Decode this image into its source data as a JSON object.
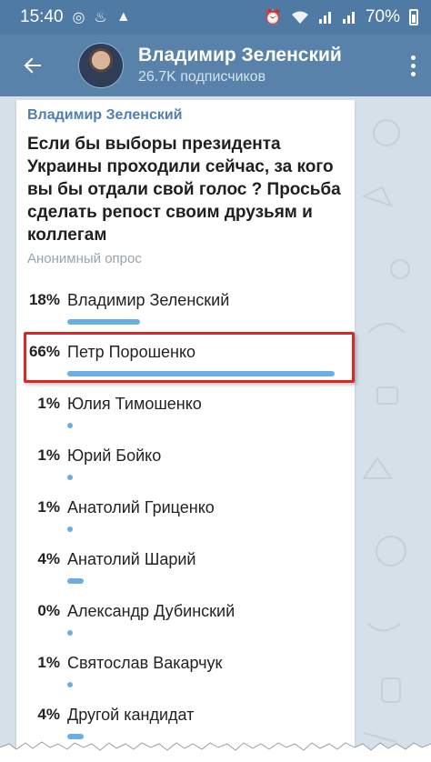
{
  "statusbar": {
    "time": "15:40",
    "battery": "70%"
  },
  "appbar": {
    "channel_name": "Владимир Зеленский",
    "subscribers": "26.7K подписчиков"
  },
  "post": {
    "author": "Владимир Зеленский",
    "question": "Если бы выборы президента Украины проходили сейчас, за кого вы бы отдали свой голос ? Просьба сделать репост своим друзьям и коллегам",
    "poll_type": "Анонимный опрос"
  },
  "poll": {
    "options": [
      {
        "percent": "18%",
        "label": "Владимир Зеленский",
        "share": 0.18
      },
      {
        "percent": "66%",
        "label": "Петр Порошенко",
        "share": 0.66
      },
      {
        "percent": "1%",
        "label": "Юлия Тимошенко",
        "share": 0.01
      },
      {
        "percent": "1%",
        "label": "Юрий Бойко",
        "share": 0.01
      },
      {
        "percent": "1%",
        "label": "Анатолий Гриценко",
        "share": 0.01
      },
      {
        "percent": "4%",
        "label": "Анатолий Шарий",
        "share": 0.04
      },
      {
        "percent": "0%",
        "label": "Александр Дубинский",
        "share": 0.0
      },
      {
        "percent": "1%",
        "label": "Святослав Вакарчук",
        "share": 0.01
      },
      {
        "percent": "4%",
        "label": "Другой кандидат",
        "share": 0.04
      }
    ]
  },
  "colors": {
    "header": "#5882a9",
    "statusbar": "#4e7aa3",
    "bar": "#6aaee3",
    "highlight": "#d9262a",
    "author": "#4f7fb0"
  },
  "icons": [
    "back-arrow-icon",
    "more-vert-icon",
    "wifi-icon",
    "signal-icon",
    "alarm-icon",
    "battery-icon"
  ]
}
